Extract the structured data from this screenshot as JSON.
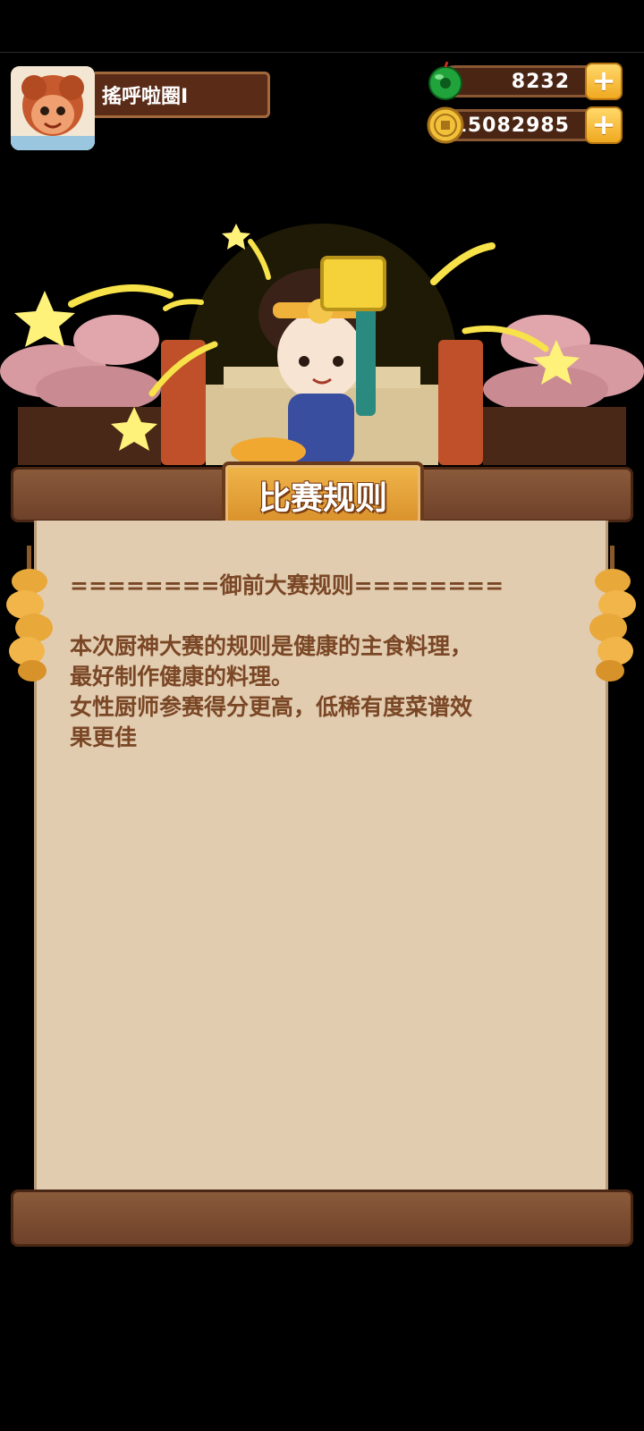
{
  "player": {
    "name": "搖呼啦圈I",
    "avatar_icon": "chef-avatar-icon"
  },
  "currencies": {
    "jade": {
      "icon": "jade-icon",
      "value": "8232",
      "add_label": "+"
    },
    "coins": {
      "icon": "coin-icon",
      "value": "15082985",
      "add_label": "+"
    }
  },
  "panel": {
    "title": "比赛规则",
    "rules": [
      "========御前大赛规则========",
      "",
      "本次厨神大赛的规则是健康的主食料理，",
      "最好制作健康的料理。",
      "女性厨师参赛得分更高，低稀有度菜谱效",
      "果更佳"
    ]
  },
  "colors": {
    "wood": "#6e4129",
    "paper": "#e2ccb0",
    "rule_text": "#7a4726",
    "title_gold": "#e9a83a"
  }
}
